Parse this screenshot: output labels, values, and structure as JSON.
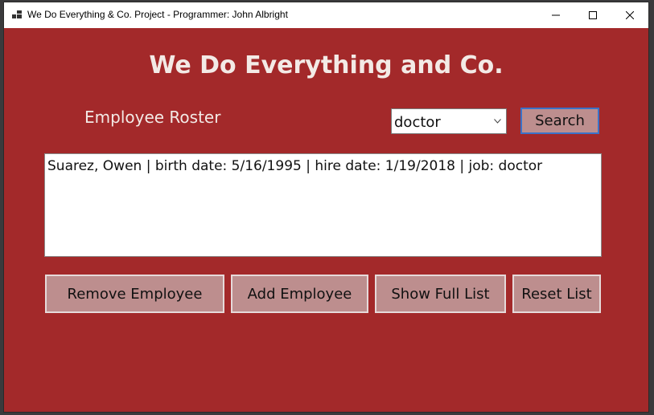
{
  "window": {
    "title": "We Do Everything & Co. Project - Programmer: John Albright",
    "controls": [
      "minimize-icon",
      "maximize-icon",
      "close-icon"
    ]
  },
  "app": {
    "heading": "We Do Everything and Co.",
    "roster_label": "Employee Roster",
    "background_color": "#a3292a"
  },
  "search": {
    "job_filter_value": "doctor",
    "search_button_label": "Search"
  },
  "employee_list": {
    "items": [
      "Suarez, Owen | birth date: 5/16/1995 | hire date: 1/19/2018 | job: doctor"
    ]
  },
  "actions": {
    "remove_label": "Remove Employee",
    "add_label": "Add Employee",
    "show_full_label": "Show Full List",
    "reset_label": "Reset List"
  }
}
